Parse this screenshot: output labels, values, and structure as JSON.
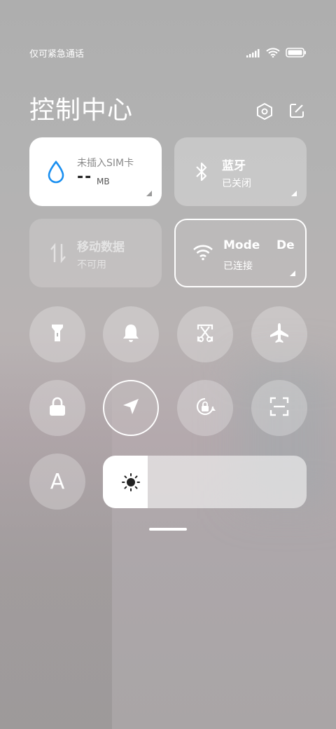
{
  "status_bar": {
    "carrier": "仅可紧急通话",
    "icons": [
      "signal-icon",
      "wifi-icon",
      "battery-icon"
    ]
  },
  "header": {
    "title": "控制中心",
    "icons": [
      "settings-icon",
      "edit-icon"
    ]
  },
  "tiles": {
    "data": {
      "title": "未插入SIM卡",
      "value": "--",
      "unit": "MB",
      "accent": "#1a8ff0"
    },
    "bluetooth": {
      "title": "蓝牙",
      "status": "已关闭"
    },
    "mobile_data": {
      "title": "移动数据",
      "status": "不可用"
    },
    "wifi": {
      "title": "Mode    De",
      "status": "已连接"
    }
  },
  "toggles": [
    "flashlight-icon",
    "bell-icon",
    "screenshot-icon",
    "airplane-icon",
    "lock-icon",
    "location-icon",
    "rotation-lock-icon",
    "scan-icon"
  ],
  "font_toggle": {
    "label": "A"
  },
  "brightness": {
    "level": 0.22
  }
}
